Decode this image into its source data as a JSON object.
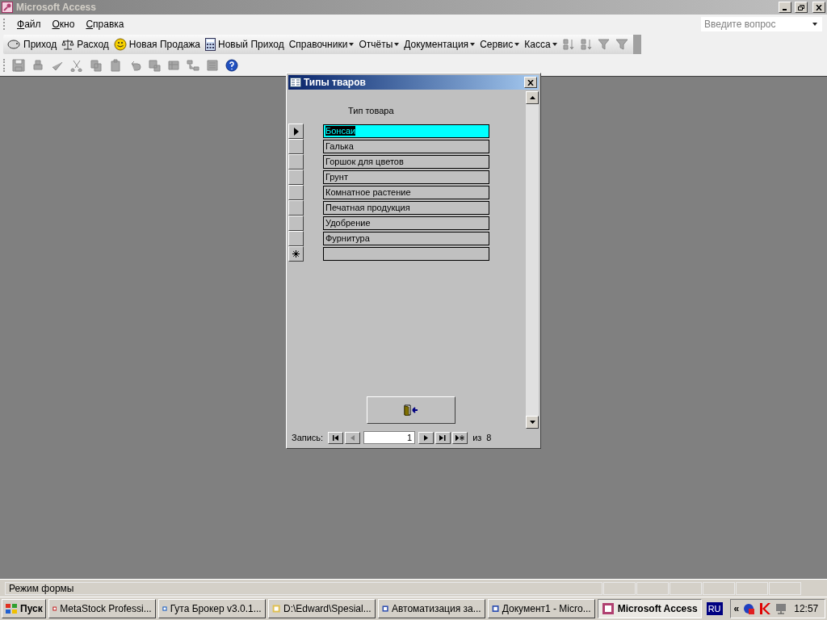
{
  "window": {
    "title": "Microsoft Access"
  },
  "menu": [
    {
      "label": "Файл"
    },
    {
      "label": "Окно"
    },
    {
      "label": "Справка"
    }
  ],
  "help_search": {
    "placeholder": "Введите вопрос"
  },
  "toolbar": [
    {
      "kind": "button",
      "label": "Приход"
    },
    {
      "kind": "button",
      "label": "Расход"
    },
    {
      "kind": "button",
      "label": "Новая Продажа"
    },
    {
      "kind": "button",
      "label": "Новый Приход"
    },
    {
      "kind": "menu",
      "label": "Справочники"
    },
    {
      "kind": "menu",
      "label": "Отчёты"
    },
    {
      "kind": "menu",
      "label": "Документация"
    },
    {
      "kind": "menu",
      "label": "Сервис"
    },
    {
      "kind": "menu",
      "label": "Касса"
    }
  ],
  "form": {
    "title": "Типы тваров",
    "column_header": "Тип товара",
    "rows": [
      {
        "value": "Бонсаи",
        "selected": true
      },
      {
        "value": "Галька",
        "selected": false
      },
      {
        "value": "Горшок для цветов",
        "selected": false
      },
      {
        "value": "Грунт",
        "selected": false
      },
      {
        "value": "Комнатное растение",
        "selected": false
      },
      {
        "value": "Печатная продукция",
        "selected": false
      },
      {
        "value": "Удобрение",
        "selected": false
      },
      {
        "value": "Фурнитура",
        "selected": false
      }
    ],
    "navigation": {
      "label": "Запись:",
      "current": "1",
      "of": "из",
      "total": "8"
    }
  },
  "status_bar": {
    "text": "Режим формы"
  },
  "taskbar": {
    "start": "Пуск",
    "tasks": [
      {
        "label": "MetaStock Professi...",
        "selected": false
      },
      {
        "label": "Гута Брокер v3.0.1...",
        "selected": false
      },
      {
        "label": "D:\\Edward\\Spesial...",
        "selected": false
      },
      {
        "label": "Автоматизация за...",
        "selected": false
      },
      {
        "label": "Документ1 - Micro...",
        "selected": false
      },
      {
        "label": "Microsoft Access",
        "selected": true
      }
    ],
    "language": "RU",
    "tray_expand": "«",
    "clock": "12:57"
  }
}
